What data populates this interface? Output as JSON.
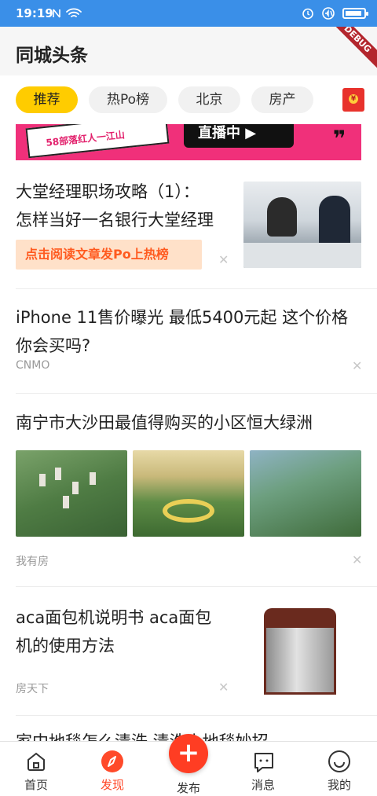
{
  "status_bar": {
    "time": "19:19",
    "icons": [
      "nfc-icon",
      "wifi-icon",
      "alarm-icon",
      "sound-icon",
      "battery-icon"
    ]
  },
  "app": {
    "title": "同城头条",
    "debug_label": "DEBUG"
  },
  "tabs": [
    {
      "label": "推荐",
      "active": true
    },
    {
      "label": "热Po榜",
      "active": false
    },
    {
      "label": "北京",
      "active": false
    },
    {
      "label": "房产",
      "active": false
    }
  ],
  "banner": {
    "sticker_text": "58部落红人一江山",
    "live_text": "直播中"
  },
  "articles": [
    {
      "title_line1": "大堂经理职场攻略（1）：",
      "title_line2": "怎样当好一名银行大堂经理",
      "promo": "点击阅读文章发Po上热榜"
    },
    {
      "title_line1": "iPhone 11售价曝光 最低5400元起 这个价格",
      "title_line2": "你会买吗?",
      "source": "CNMO"
    },
    {
      "title_line1": "南宁市大沙田最值得购买的小区恒大绿洲",
      "source": "我有房"
    },
    {
      "title_line1": "aca面包机说明书 aca面包",
      "title_line2": "机的使用方法",
      "source": "房天下"
    },
    {
      "title_line1": "家中地毯怎么清洗 清洗小地毯妙招"
    }
  ],
  "bottom_nav": [
    {
      "label": "首页",
      "icon": "home-icon",
      "active": false
    },
    {
      "label": "发现",
      "icon": "compass-icon",
      "active": true
    },
    {
      "label": "发布",
      "icon": "plus-icon",
      "active": false
    },
    {
      "label": "消息",
      "icon": "message-icon",
      "active": false
    },
    {
      "label": "我的",
      "icon": "smile-icon",
      "active": false
    }
  ],
  "colors": {
    "status_bar": "#3a8fe8",
    "accent_yellow": "#ffcc00",
    "accent_red": "#ff3d23",
    "promo_text": "#ff5a1f"
  }
}
